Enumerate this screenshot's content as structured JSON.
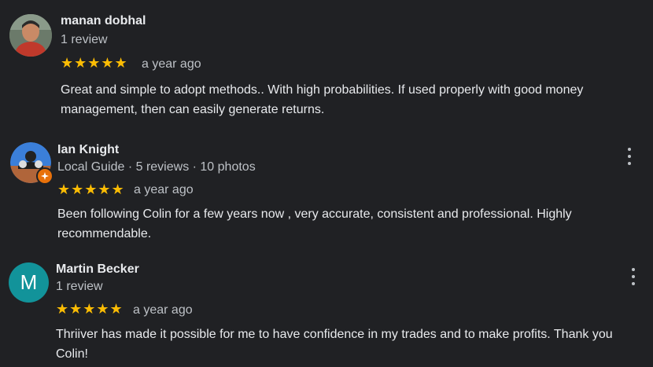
{
  "reviews": [
    {
      "name": "manan dobhal",
      "meta": "1 review",
      "stars": "★★★★★",
      "rating": 5,
      "date": "a year ago",
      "text": "Great and simple to adopt methods.. With high probabilities. If used properly with good money management, then can easily generate  returns."
    },
    {
      "name": "Ian Knight",
      "meta": "Local Guide · 5 reviews · 10 photos",
      "stars": "★★★★★",
      "rating": 5,
      "date": "a year ago",
      "text": "Been following Colin for a few years now , very accurate, consistent and professional. Highly recommendable."
    },
    {
      "name": "Martin Becker",
      "meta": "1 review",
      "avatar_letter": "M",
      "stars": "★★★★★",
      "rating": 5,
      "date": "a year ago",
      "text": "Thriiver has made it possible for me to have confidence in my trades and to make profits. Thank you Colin!"
    }
  ],
  "colors": {
    "background": "#202124",
    "star": "#fbbc04",
    "avatar_teal": "#12939a",
    "local_guide_badge": "#e8710a"
  },
  "icons": {
    "more_options": "more-vert-icon",
    "local_guide_badge": "local-guide-badge-icon"
  }
}
